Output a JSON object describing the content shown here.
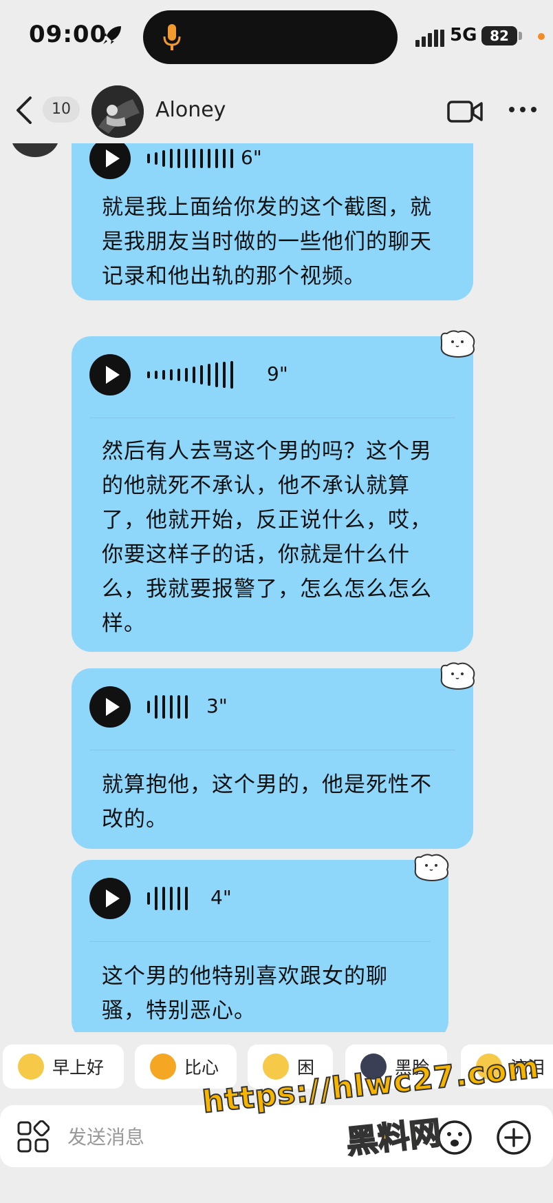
{
  "status_bar": {
    "time": "09:00",
    "network": "5G",
    "battery": "82",
    "icons": [
      "rocket-icon",
      "microphone-icon",
      "signal-icon",
      "battery-icon"
    ]
  },
  "header": {
    "back_icon": "chevron-left-icon",
    "unread_count": "10",
    "contact_name": "Aloney",
    "actions": [
      "video-call-icon",
      "more-icon"
    ]
  },
  "messages": [
    {
      "duration": "6\"",
      "text": "就是我上面给你发的这个截图，就是我朋友当时做的一些他们的聊天记录和他出轨的那个视频。"
    },
    {
      "duration": "9\"",
      "text": "然后有人去骂这个男的吗？这个男的他就死不承认，他不承认就算了，他就开始，反正说什么，哎，你要这样子的话，你就是什么什么，我就要报警了，怎么怎么怎么样。"
    },
    {
      "duration": "3\"",
      "text": "就算抱他，这个男的，他是死性不改的。"
    },
    {
      "duration": "4\"",
      "text": "这个男的他特别喜欢跟女的聊骚，特别恶心。"
    }
  ],
  "quick_replies": [
    {
      "label": "早上好",
      "icon": "sun-emoji-icon",
      "color": "#f7c948"
    },
    {
      "label": "比心",
      "icon": "heart-hands-emoji-icon",
      "color": "#f5a623"
    },
    {
      "label": "困",
      "icon": "sleepy-emoji-icon",
      "color": "#f7c948"
    },
    {
      "label": "黑脸",
      "icon": "dark-face-emoji-icon",
      "color": "#3a3f55"
    },
    {
      "label": "流泪",
      "icon": "crying-emoji-icon",
      "color": "#f7c948"
    }
  ],
  "input_bar": {
    "placeholder": "发送消息",
    "icons": [
      "apps-grid-icon",
      "emoji-icon",
      "plus-icon"
    ]
  },
  "watermark": {
    "url": "https://hlwc27.com",
    "name": "黑料网"
  }
}
